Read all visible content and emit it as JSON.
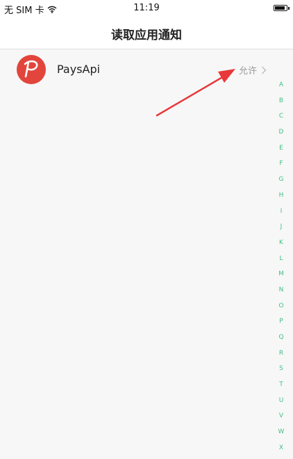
{
  "status_bar": {
    "carrier": "无 SIM 卡",
    "time": "11:19",
    "battery_level": 0.9
  },
  "nav": {
    "title": "读取应用通知"
  },
  "apps": [
    {
      "name": "PaysApi",
      "status": "允许",
      "icon": "paysapi-logo-icon",
      "icon_color": "#e2453c"
    }
  ],
  "index_letters": [
    "A",
    "B",
    "C",
    "D",
    "E",
    "F",
    "G",
    "H",
    "I",
    "J",
    "K",
    "L",
    "M",
    "N",
    "O",
    "P",
    "Q",
    "R",
    "S",
    "T",
    "U",
    "V",
    "W",
    "X"
  ],
  "annotation": {
    "arrow_color": "#e8383a"
  },
  "colors": {
    "index": "#3fc083",
    "status_text": "#9a9a9a",
    "background": "#f7f7f7"
  }
}
